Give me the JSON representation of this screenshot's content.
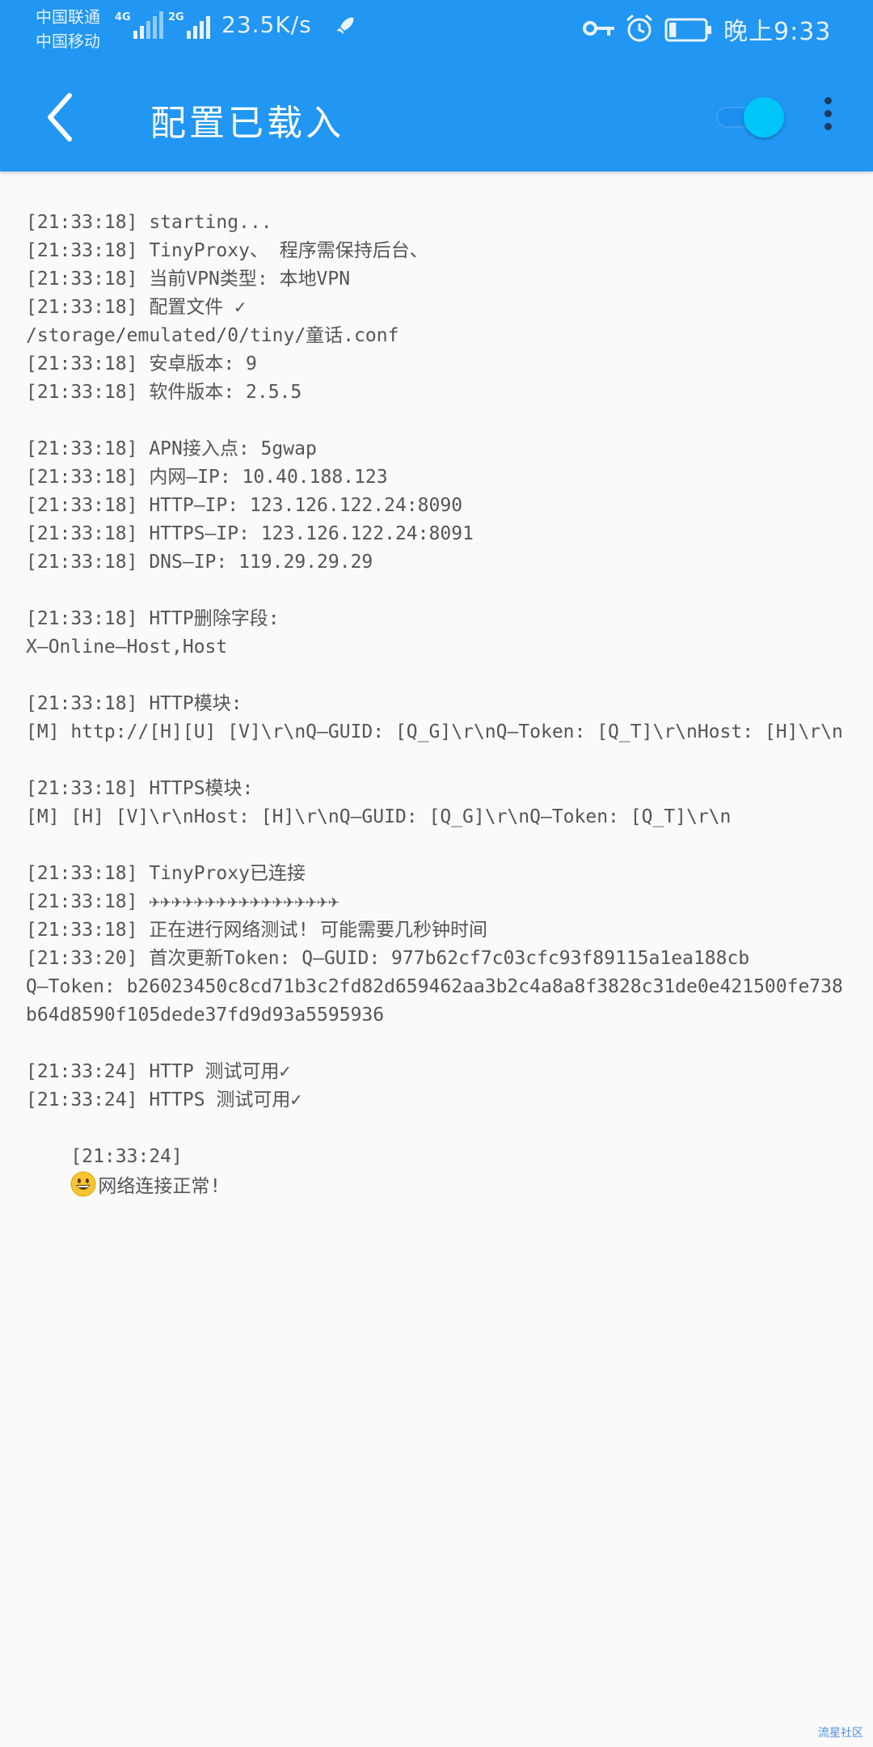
{
  "status_bar": {
    "carrier1": "中国联通",
    "carrier2": "中国移动",
    "sim1_network": "4G",
    "sim2_network": "2G",
    "net_speed": "23.5K/s",
    "clock": "晚上9:33",
    "battery_level": 0.2,
    "icons": [
      "signal-icon",
      "rocket-icon",
      "key-icon",
      "alarm-icon",
      "battery-icon"
    ]
  },
  "toolbar": {
    "title": "配置已载入",
    "back_icon": "back-arrow-icon",
    "toggle_on": true,
    "more_icon": "more-vertical-icon",
    "colors": {
      "bar": "#2196f3",
      "toggle_thumb": "#00c6f7"
    }
  },
  "log": {
    "lines": [
      "[21:33:18] starting...",
      "[21:33:18] TinyProxy、 程序需保持后台、",
      "[21:33:18] 当前VPN类型: 本地VPN",
      "[21:33:18] 配置文件 ✓",
      "/storage/emulated/0/tiny/童话.conf",
      "[21:33:18] 安卓版本: 9",
      "[21:33:18] 软件版本: 2.5.5",
      "",
      "[21:33:18] APN接入点: 5gwap",
      "[21:33:18] 内网—IP: 10.40.188.123",
      "[21:33:18] HTTP—IP: 123.126.122.24:8090",
      "[21:33:18] HTTPS—IP: 123.126.122.24:8091",
      "[21:33:18] DNS—IP: 119.29.29.29",
      "",
      "[21:33:18] HTTP删除字段:",
      "X—Online—Host,Host",
      "",
      "[21:33:18] HTTP模块:",
      "[M] http://[H][U] [V]\\r\\nQ—GUID: [Q_G]\\r\\nQ—Token: [Q_T]\\r\\nHost: [H]\\r\\n",
      "",
      "[21:33:18] HTTPS模块:",
      "[M] [H] [V]\\r\\nHost: [H]\\r\\nQ—GUID: [Q_G]\\r\\nQ—Token: [Q_T]\\r\\n",
      "",
      "[21:33:18] TinyProxy已连接",
      "[21:33:18] ✈✈✈✈✈✈✈✈✈✈✈✈✈✈✈✈✈",
      "[21:33:18] 正在进行网络测试! 可能需要几秒钟时间",
      "[21:33:20] 首次更新Token: Q—GUID: 977b62cf7c03cfc93f89115a1ea188cb",
      "Q—Token: b26023450c8cd71b3c2fd82d659462aa3b2c4a8a8f3828c31de0e421500fe738",
      "b64d8590f105dede37fd9d93a5595936",
      "",
      "[21:33:24] HTTP 测试可用✓",
      "[21:33:24] HTTPS 测试可用✓"
    ],
    "final_line": {
      "timestamp": "[21:33:24]",
      "icon": "grinning-face-emoji",
      "text": "网络连接正常!"
    }
  },
  "watermark": "流星社区"
}
